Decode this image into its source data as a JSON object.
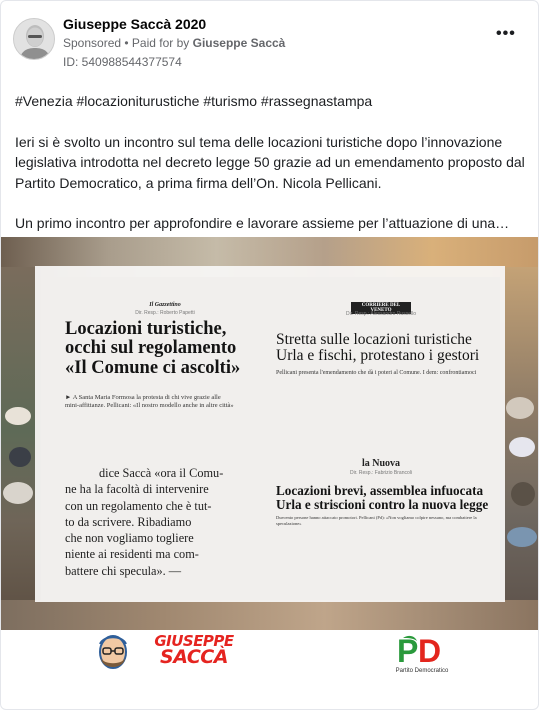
{
  "post": {
    "page_name": "Giuseppe Saccà 2020",
    "sponsored": "Sponsored",
    "separator": " • ",
    "paid_for_prefix": "Paid for by ",
    "paid_for_name": "Giuseppe Saccà",
    "ad_id": "ID: 540988544377574",
    "more_icon": "more-horizontal-icon",
    "more_label": "•••"
  },
  "body": {
    "hashtags": "#Venezia #locazioniturustiche #turismo #rassegnastampa",
    "paragraph": "Ieri si è svolto un incontro sul tema delle locazioni turistiche dopo l’innovazione legislativa introdotta nel decreto legge 50 grazie ad un emendamento proposto dal Partito Democratico, a prima firma dell’On. Nicola Pellicani.",
    "teaser": "Un primo incontro per approfondire e lavorare assieme per l’attuazione di una…"
  },
  "clippings": {
    "gazzettino": {
      "masthead": "Il Gazzettino",
      "byline": "Dir. Resp.: Roberto Papetti",
      "headline_1": "Locazioni turistiche,",
      "headline_2": "occhi sul regolamento",
      "headline_3": "«Il Comune ci ascolti»",
      "sub_1": "► A Santa Maria Formosa la protesta di chi vive grazie alle",
      "sub_2": "mini-affittanze. Pellicani: «Il nostro modello anche in altre città»"
    },
    "corriere": {
      "masthead": "CORRIERE DEL VENETO",
      "byline": "Dir. Resp.: Alessandro Russello",
      "headline_1": "Stretta sulle locazioni turistiche",
      "headline_2": "Urla e fischi, protestano i gestori",
      "sub": "Pellicani presenta l'emendamento che dà i poteri al Comune. I dem: confrontiamoci"
    },
    "nuova": {
      "masthead": "la Nuova",
      "byline": "Dir. Resp.: Fabrizio Brancoli",
      "headline_1": "Locazioni brevi, assemblea infuocata",
      "headline_2": "Urla e striscioni contro la nuova legge",
      "sub": "Duecento persone hanno attaccato promotori. Pellicani (Pd): «Non vogliamo colpire nessuno, ma combattere la speculazione»"
    },
    "quote_lines": [
      "dice Saccà «ora il Comu-",
      "ne ha la facoltà di intervenire",
      "con un regolamento che è tut-",
      "to da scrivere. Ribadiamo",
      "che non vogliamo togliere",
      "niente ai residenti ma com-",
      "battere chi specula». —"
    ]
  },
  "footer": {
    "logo_line_1": "GIUSEPPE",
    "logo_line_2": "SACCÀ",
    "pd_letters": "PD",
    "pd_caption": "Partito Democratico"
  },
  "colors": {
    "accent_red": "#e52420",
    "pd_green": "#2a9a3c",
    "pd_red": "#e3261d"
  }
}
